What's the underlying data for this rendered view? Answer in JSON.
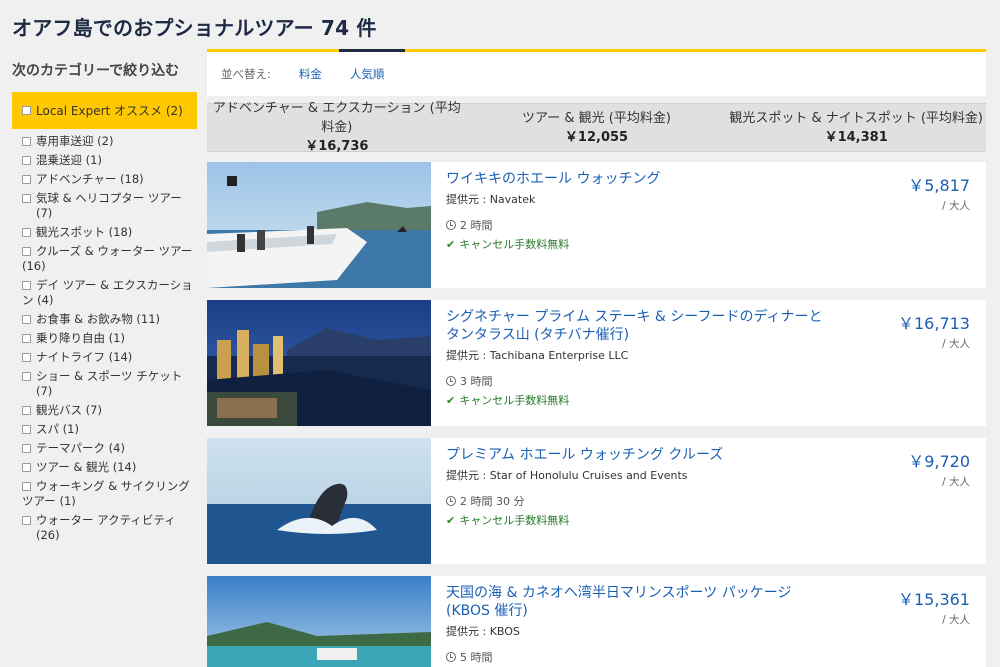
{
  "page": {
    "title": "オアフ島でのおプショナルツアー 74 件"
  },
  "sidebar": {
    "heading": "次のカテゴリーで絞り込む",
    "featured": "Local Expert オススメ (2)",
    "categories": [
      "専用車送迎 (2)",
      "混乗送迎 (1)",
      "アドベンチャー (18)",
      "気球 & ヘリコプター ツアー (7)",
      "観光スポット (18)",
      "クルーズ & ウォーター ツアー (16)",
      "デイ ツアー & エクスカーション (4)",
      "お食事 & お飲み物 (11)",
      "乗り降り自由 (1)",
      "ナイトライフ (14)",
      "ショー & スポーツ チケット (7)",
      "観光バス (7)",
      "スパ (1)",
      "テーマパーク (4)",
      "ツアー & 観光 (14)",
      "ウォーキング & サイクリング ツアー (1)",
      "ウォーター アクティビティ (26)"
    ]
  },
  "sort": {
    "label": "並べ替え:",
    "options": [
      "料金",
      "人気順"
    ]
  },
  "averages": [
    {
      "label": "アドベンチャー & エクスカーション (平均料金)",
      "price": "￥16,736"
    },
    {
      "label": "ツアー & 観光 (平均料金)",
      "price": "￥12,055"
    },
    {
      "label": "観光スポット & ナイトスポット (平均料金)",
      "price": "￥14,381"
    }
  ],
  "tours": [
    {
      "title": "ワイキキのホエール ウォッチング",
      "provider": "提供元 : Navatek",
      "duration": "2 時間",
      "cancel": "キャンセル手数料無料",
      "price": "￥5,817",
      "per": "/ 大人"
    },
    {
      "title": "シグネチャー プライム ステーキ & シーフードのディナーとタンタラス山 (タチバナ催行)",
      "provider": "提供元 : Tachibana Enterprise LLC",
      "duration": "3 時間",
      "cancel": "キャンセル手数料無料",
      "price": "￥16,713",
      "per": "/ 大人"
    },
    {
      "title": "プレミアム ホエール ウォッチング クルーズ",
      "provider": "提供元 : Star of Honolulu Cruises and Events",
      "duration": "2 時間 30 分",
      "cancel": "キャンセル手数料無料",
      "price": "￥9,720",
      "per": "/ 大人"
    },
    {
      "title": "天国の海 & カネオヘ湾半日マリンスポーツ パッケージ (KBOS 催行)",
      "provider": "提供元 : KBOS",
      "duration": "5 時間",
      "cancel": "",
      "price": "￥15,361",
      "per": "/ 大人"
    }
  ]
}
